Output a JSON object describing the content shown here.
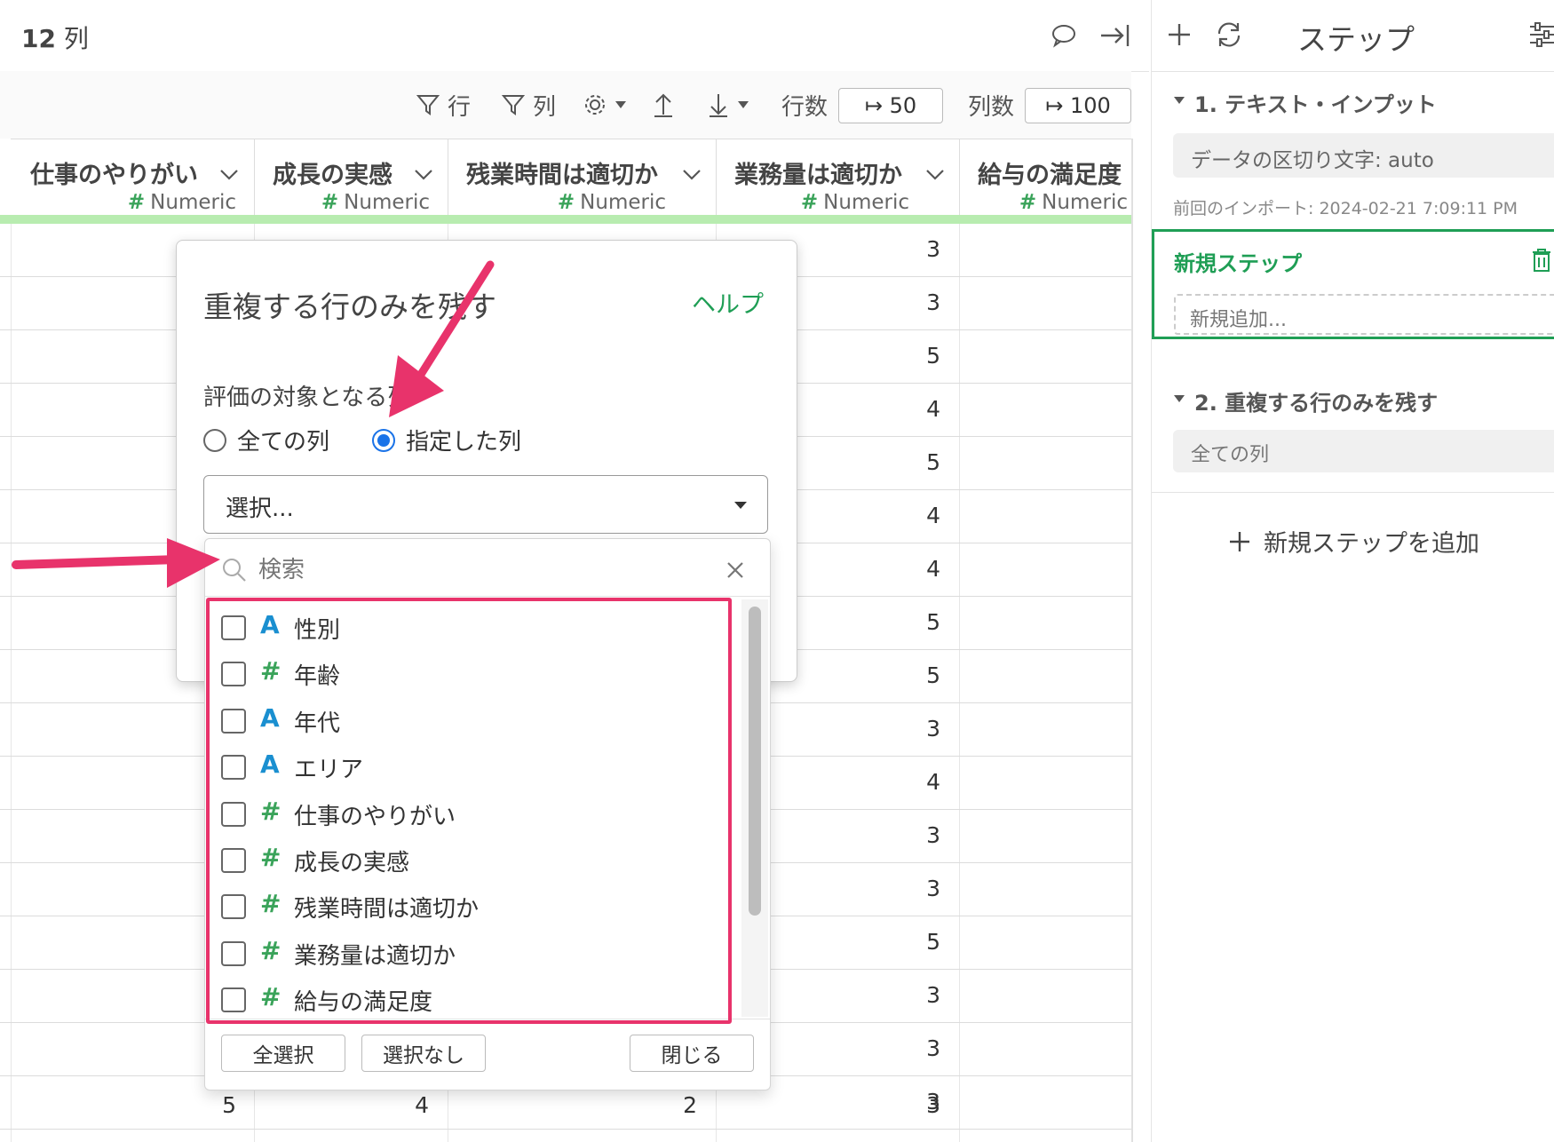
{
  "topbar": {
    "col_count": "12",
    "col_unit": "列"
  },
  "toolbar": {
    "row_filter": "行",
    "col_filter": "列",
    "rows_label": "行数",
    "rows_value": "↦ 50",
    "cols_label": "列数",
    "cols_value": "↦ 100"
  },
  "columns": [
    {
      "name": "仕事のやりがい",
      "type": "Numeric"
    },
    {
      "name": "成長の実感",
      "type": "Numeric"
    },
    {
      "name": "残業時間は適切か",
      "type": "Numeric"
    },
    {
      "name": "業務量は適切か",
      "type": "Numeric"
    },
    {
      "name": "給与の満足度",
      "type": "Numeric"
    }
  ],
  "col4_values": [
    "3",
    "3",
    "5",
    "4",
    "5",
    "4",
    "4",
    "5",
    "5",
    "3",
    "4",
    "3",
    "3",
    "5",
    "3",
    "3",
    "3"
  ],
  "last_row": [
    "5",
    "4",
    "2",
    "3"
  ],
  "dialog": {
    "title": "重複する行のみを残す",
    "help": "ヘルプ",
    "target_label": "評価の対象となる列",
    "radio_all": "全ての列",
    "radio_selected": "指定した列",
    "select_placeholder": "選択..."
  },
  "dropdown": {
    "search_placeholder": "検索",
    "options": [
      {
        "type": "A",
        "label": "性別"
      },
      {
        "type": "#",
        "label": "年齢"
      },
      {
        "type": "A",
        "label": "年代"
      },
      {
        "type": "A",
        "label": "エリア"
      },
      {
        "type": "#",
        "label": "仕事のやりがい"
      },
      {
        "type": "#",
        "label": "成長の実感"
      },
      {
        "type": "#",
        "label": "残業時間は適切か"
      },
      {
        "type": "#",
        "label": "業務量は適切か"
      },
      {
        "type": "#",
        "label": "給与の満足度"
      }
    ],
    "select_all": "全選択",
    "select_none": "選択なし",
    "close": "閉じる"
  },
  "steps_panel": {
    "title": "ステップ",
    "step1_title": "1. テキスト・インプット",
    "step1_detail": "データの区切り文字: auto",
    "step1_meta": "前回のインポート: 2024-02-21 7:09:11 PM",
    "new_step_title": "新規ステップ",
    "new_step_placeholder": "新規追加...",
    "step2_title": "2. 重複する行のみを残す",
    "step2_detail": "全ての列",
    "add_step": "新規ステップを追加"
  },
  "colors": {
    "accent_green": "#1f9e55",
    "highlight_pink": "#e8336b",
    "radio_blue": "#1a73e8"
  }
}
